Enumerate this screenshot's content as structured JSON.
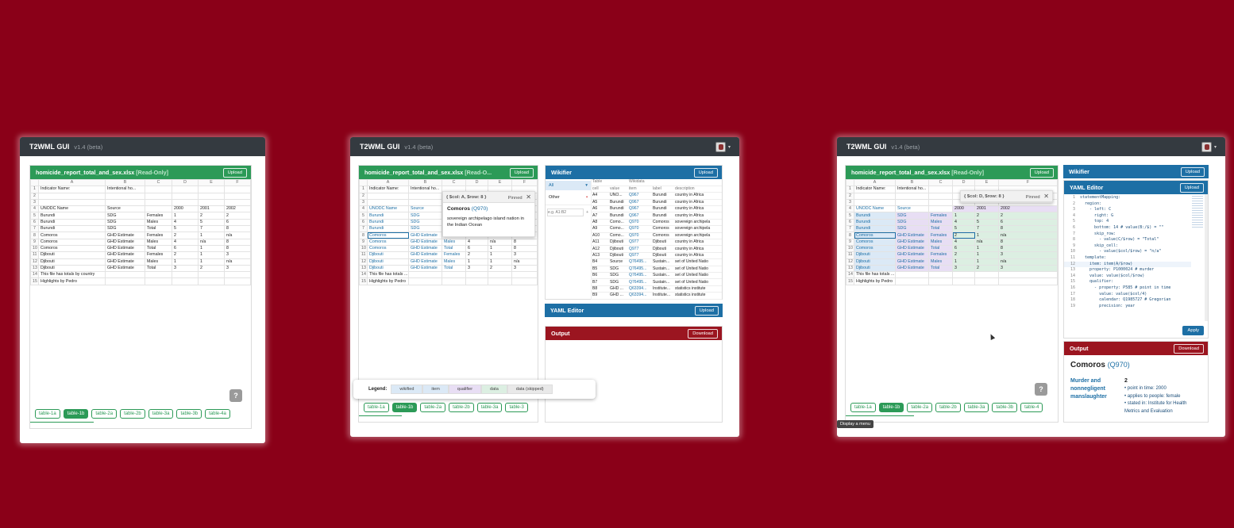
{
  "app": {
    "brand": "T2WML GUI",
    "version": "v1.4 (beta)"
  },
  "colors": {
    "background": "#8a0018",
    "sheet_header": "#2c9a57",
    "wikifier_header": "#1d6fa5",
    "output_header": "#9b1520"
  },
  "sheet": {
    "filename": "homicide_report_total_and_sex.xlsx",
    "readonly": "[Read-Only]",
    "readonly_truncated": "[Read-O...",
    "upload": "Upload",
    "cols": [
      "",
      "A",
      "B",
      "C",
      "D",
      "E",
      "F"
    ],
    "rows": [
      [
        "1",
        "Indicator Name:",
        "Intentional ho...",
        "",
        "",
        "",
        ""
      ],
      [
        "2",
        "",
        "",
        "",
        "",
        "",
        ""
      ],
      [
        "3",
        "",
        "",
        "",
        "",
        "",
        ""
      ],
      [
        "4",
        "UNODC Name",
        "Source",
        "",
        "2000",
        "2001",
        "2002"
      ],
      [
        "5",
        "Burundi",
        "SDG",
        "Females",
        "1",
        "2",
        "2"
      ],
      [
        "6",
        "Burundi",
        "SDG",
        "Males",
        "4",
        "5",
        "6"
      ],
      [
        "7",
        "Burundi",
        "SDG",
        "Total",
        "5",
        "7",
        "8"
      ],
      [
        "8",
        "Comoros",
        "GHD Estimate",
        "Females",
        "2",
        "1",
        "n/a"
      ],
      [
        "9",
        "Comoros",
        "GHD Estimate",
        "Males",
        "4",
        "n/a",
        "8"
      ],
      [
        "10",
        "Comoros",
        "GHD Estimate",
        "Total",
        "6",
        "1",
        "8"
      ],
      [
        "11",
        "Djibouti",
        "GHD Estimate",
        "Females",
        "2",
        "1",
        "3"
      ],
      [
        "12",
        "Djibouti",
        "GHD Estimate",
        "Males",
        "1",
        "1",
        "n/a"
      ],
      [
        "13",
        "Djibouti",
        "GHD Estimate",
        "Total",
        "3",
        "2",
        "3"
      ],
      [
        "14",
        "This file has totals by country",
        "",
        "",
        "",
        "",
        ""
      ],
      [
        "15",
        "Highlights by Pedro",
        "",
        "",
        "",
        "",
        ""
      ]
    ],
    "row14_short": "This file has totals ...",
    "tabs": [
      "table-1a",
      "table-1b",
      "table-2a",
      "table-2b",
      "table-3a",
      "table-3b",
      "table-4a"
    ],
    "tabs_short": [
      "table-1a",
      "table-1b",
      "table-2a",
      "table-2b",
      "table-3a",
      "table-3"
    ],
    "tabs_mid": [
      "table-1a",
      "table-1b",
      "table-2a",
      "table-2b",
      "table-3a",
      "table-3b",
      "table-4"
    ],
    "help": "?"
  },
  "tooltip1": {
    "title": "{ $col: A, $row: 8 }",
    "pinned": "Pinned",
    "item": "Comoros",
    "qid": "(Q970)",
    "desc": "sovereign archipelago island nation in the Indian Ocean"
  },
  "tooltip3": {
    "title": "{ $col: D, $row: 8 }",
    "pinned": "Pinned"
  },
  "wikifier": {
    "title": "Wikifier",
    "upload": "Upload",
    "filter_all": "All",
    "filter_other": "Other",
    "search_placeholder": "e.g. A1:B2",
    "plus": "+",
    "group_table": "Table",
    "group_wikidata": "Wikidata",
    "headers": [
      "cell",
      "value",
      "item",
      "label",
      "description"
    ],
    "rows": [
      [
        "A4",
        "UNO...",
        "Q967",
        "Burundi",
        "country in Africa"
      ],
      [
        "A5",
        "Burundi",
        "Q967",
        "Burundi",
        "country in Africa"
      ],
      [
        "A6",
        "Burundi",
        "Q967",
        "Burundi",
        "country in Africa"
      ],
      [
        "A7",
        "Burundi",
        "Q967",
        "Burundi",
        "country in Africa"
      ],
      [
        "A8",
        "Como...",
        "Q970",
        "Comoros",
        "sovereign archipela"
      ],
      [
        "A9",
        "Como...",
        "Q970",
        "Comoros",
        "sovereign archipela"
      ],
      [
        "A10",
        "Como...",
        "Q970",
        "Comoros",
        "sovereign archipela"
      ],
      [
        "A11",
        "Djibouti",
        "Q977",
        "Djibouti",
        "country in Africa"
      ],
      [
        "A12",
        "Djibouti",
        "Q977",
        "Djibouti",
        "country in Africa"
      ],
      [
        "A13",
        "Djibouti",
        "Q977",
        "Djibouti",
        "country in Africa"
      ],
      [
        "B4",
        "Source",
        "Q76495...",
        "Sustain...",
        "set of United Natio"
      ],
      [
        "B5",
        "SDG",
        "Q76495...",
        "Sustain...",
        "set of United Natio"
      ],
      [
        "B6",
        "SDG",
        "Q76495...",
        "Sustain...",
        "set of United Natio"
      ],
      [
        "B7",
        "SDG",
        "Q76495...",
        "Sustain...",
        "set of United Natio"
      ],
      [
        "B8",
        "GHD ...",
        "Q63394...",
        "Institute...",
        "statistics institute"
      ],
      [
        "B9",
        "GHD ...",
        "Q63394...",
        "Institute...",
        "statistics institute"
      ]
    ]
  },
  "yaml": {
    "title": "YAML Editor",
    "upload": "Upload",
    "apply": "Apply",
    "lines": [
      [
        "1",
        "statementMapping:"
      ],
      [
        "2",
        "  region:"
      ],
      [
        "3",
        "    - left: C"
      ],
      [
        "4",
        "      right: G"
      ],
      [
        "5",
        "      top: 4"
      ],
      [
        "6",
        "      bottom: 14 # value(B:/$) = \"\""
      ],
      [
        "7",
        "      skip_row:"
      ],
      [
        "8",
        "        - value(C/$row) = \"Total\""
      ],
      [
        "9",
        "      skip_cell:"
      ],
      [
        "10",
        "        - value($col/$row) = \"n/a\""
      ],
      [
        "11",
        "  template:"
      ],
      [
        "12",
        "    item: item(A/$row)"
      ],
      [
        "13",
        "    property: P1000024 # murder"
      ],
      [
        "14",
        "    value: value($col/$row)"
      ],
      [
        "15",
        "    qualifier:"
      ],
      [
        "16",
        "      - property: P585 # point in time"
      ],
      [
        "17",
        "        value: value($col/4)"
      ],
      [
        "18",
        "        calendar: Q1985727 # Gregorian"
      ],
      [
        "19",
        "        precision: year"
      ]
    ]
  },
  "output": {
    "title": "Output",
    "download": "Download",
    "item": "Comoros",
    "qid": "(Q970)",
    "prop_label": "Murder and nonnegligent manslaughter",
    "value": "2",
    "qualifiers": [
      "point in time: 2000",
      "applies to people: female",
      "stated in: Institute for Health Metrics and Evaluation"
    ]
  },
  "legend": {
    "label": "Legend:",
    "items": [
      "wikified",
      "item",
      "qualifier",
      "data",
      "data (skipped)"
    ]
  },
  "status": {
    "tooltip": "Display a menu"
  }
}
